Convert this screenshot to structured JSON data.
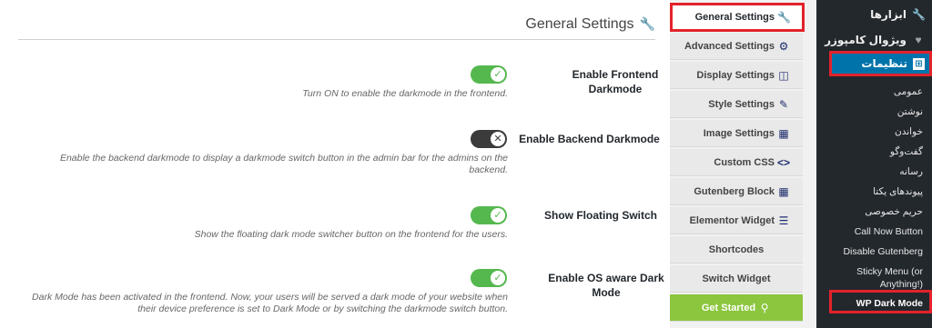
{
  "panel": {
    "title": "General Settings",
    "settings": [
      {
        "label": "Enable Frontend Darkmode",
        "state": "on",
        "description": "Turn ON to enable the darkmode in the frontend."
      },
      {
        "label": "Enable Backend Darkmode",
        "state": "off",
        "description": "Enable the backend darkmode to display a darkmode switch button in the admin bar for the admins on the backend."
      },
      {
        "label": "Show Floating Switch",
        "state": "on",
        "description": "Show the floating dark mode switcher button on the frontend for the users."
      },
      {
        "label": "Enable OS aware Dark Mode",
        "state": "on",
        "description": "Dark Mode has been activated in the frontend. Now, your users will be served a dark mode of your website when their device preference is set to Dark Mode or by switching the darkmode switch button."
      }
    ]
  },
  "tabs": [
    {
      "label": "General Settings",
      "icon": "wrench-icon",
      "active": true
    },
    {
      "label": "Advanced Settings",
      "icon": "gear-icon"
    },
    {
      "label": "Display Settings",
      "icon": "monitor-icon"
    },
    {
      "label": "Style Settings",
      "icon": "brush-icon"
    },
    {
      "label": "Image Settings",
      "icon": "image-icon"
    },
    {
      "label": "Custom CSS",
      "icon": "code-icon"
    },
    {
      "label": "Gutenberg Block",
      "icon": "blocks-icon"
    },
    {
      "label": "Elementor Widget",
      "icon": "widget-icon"
    },
    {
      "label": "Shortcodes",
      "icon": ""
    },
    {
      "label": "Switch Widget",
      "icon": ""
    },
    {
      "label": "Get Started",
      "icon": "pin-icon"
    }
  ],
  "sidebar": {
    "top_items": [
      {
        "label": "ابزارها",
        "icon": "wrench-icon"
      },
      {
        "label": "ویژوال کامپوزر",
        "icon": "puzzle-icon"
      }
    ],
    "active_menu": {
      "label": "تنظیمات",
      "icon": "settings-icon"
    },
    "submenu": [
      "عمومی",
      "نوشتن",
      "خواندن",
      "گفت‌وگو",
      "رسانه",
      "پیوندهای یکتا",
      "حریم خصوصی",
      "Call Now Button",
      "Disable Gutenberg",
      "Sticky Menu (or Anything!)",
      "WP Dark Mode"
    ]
  },
  "colors": {
    "accent": "#0073aa",
    "highlight": "#e3222b",
    "toggle_on": "#55b84f",
    "get_started": "#8cc63f"
  }
}
